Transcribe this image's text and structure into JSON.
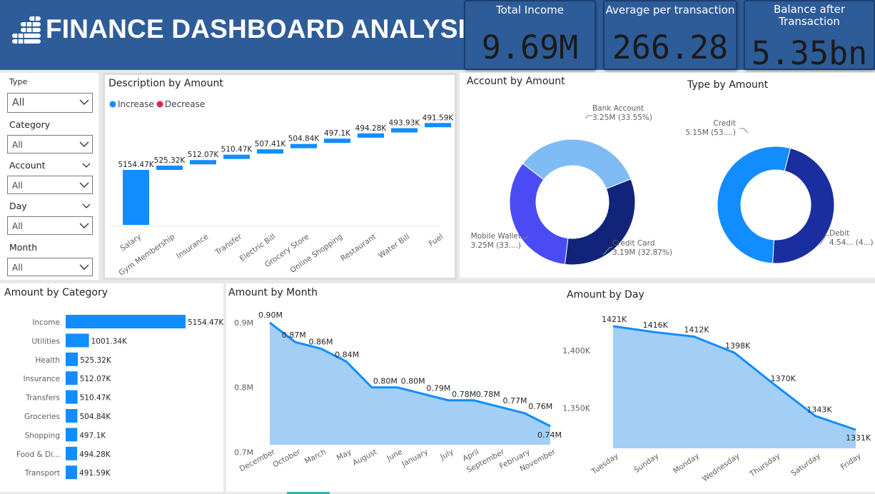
{
  "header": {
    "title": "FINANCE DASHBOARD ANALYSIS",
    "logo_icon": "coin-stack-icon"
  },
  "kpis": [
    {
      "label": "Total Income",
      "value": "9.69M"
    },
    {
      "label": "Average per transaction",
      "value": "266.28"
    },
    {
      "label": "Balance after Transaction",
      "value": "5.35bn"
    }
  ],
  "slicers": [
    {
      "label": "Type",
      "value": "All"
    },
    {
      "label": "Category",
      "value": "All"
    },
    {
      "label": "Account",
      "value": "All"
    },
    {
      "label": "Day",
      "value": "All"
    },
    {
      "label": "Month",
      "value": "All"
    }
  ],
  "colors": {
    "accent": "#118dff",
    "decrease": "#e6224d",
    "header": "#2e5c99",
    "area": "#a3cff7"
  },
  "chart_data": [
    {
      "id": "description",
      "type": "waterfall",
      "title": "Description by Amount",
      "legend": [
        {
          "name": "Increase",
          "color": "#118dff"
        },
        {
          "name": "Decrease",
          "color": "#e6224d"
        }
      ],
      "categories": [
        "Salary",
        "Gym Membership",
        "Insurance",
        "Transfer",
        "Electric Bill",
        "Grocery Store",
        "Online Shopping",
        "Restaurant",
        "Water Bill",
        "Fuel"
      ],
      "labels": [
        "5154.47K",
        "525.32K",
        "512.07K",
        "510.47K",
        "507.41K",
        "504.84K",
        "497.1K",
        "494.28K",
        "493.93K",
        "491.59K"
      ],
      "values": [
        5154.47,
        525.32,
        512.07,
        510.47,
        507.41,
        504.84,
        497.1,
        494.28,
        493.93,
        491.59
      ]
    },
    {
      "id": "account",
      "type": "donut",
      "title": "Account by Amount",
      "slices": [
        {
          "name": "Bank Account",
          "value": 33.55,
          "label": "3.25M (33.55%)",
          "color": "#7fbcf6"
        },
        {
          "name": "Credit Card",
          "value": 32.87,
          "label": "3.19M (32.87%)",
          "color": "#12247a"
        },
        {
          "name": "Mobile Wallet",
          "value": 33.58,
          "label": "3.25M (33....)",
          "color": "#4a4bf4"
        }
      ]
    },
    {
      "id": "type",
      "type": "donut",
      "title": "Type by Amount",
      "slices": [
        {
          "name": "Debit",
          "value": 46.85,
          "label": "4.54... (4...)",
          "color": "#1a2ea0"
        },
        {
          "name": "Credit",
          "value": 53.15,
          "label": "5.15M (53....)",
          "color": "#118dff"
        }
      ]
    },
    {
      "id": "category",
      "type": "bar",
      "title": "Amount by Category",
      "categories": [
        "Income",
        "Utilities",
        "Health",
        "Insurance",
        "Transfers",
        "Groceries",
        "Shopping",
        "Food & Di...",
        "Transport"
      ],
      "labels": [
        "5154.47K",
        "1001.34K",
        "525.32K",
        "512.07K",
        "510.47K",
        "504.84K",
        "497.1K",
        "494.28K",
        "491.59K"
      ],
      "values": [
        5154.47,
        1001.34,
        525.32,
        512.07,
        510.47,
        504.84,
        497.1,
        494.28,
        491.59
      ]
    },
    {
      "id": "month",
      "type": "area",
      "title": "Amount by Month",
      "categories": [
        "December",
        "October",
        "March",
        "May",
        "August",
        "June",
        "January",
        "July",
        "April",
        "September",
        "February",
        "November"
      ],
      "values": [
        0.9,
        0.87,
        0.86,
        0.84,
        0.8,
        0.8,
        0.79,
        0.78,
        0.78,
        0.77,
        0.76,
        0.74
      ],
      "labels": [
        "0.90M",
        "0.87M",
        "0.86M",
        "0.84M",
        "0.80M",
        "0.80M",
        "0.79M",
        "0.78M",
        "0.78M",
        "0.77M",
        "0.76M",
        "0.74M"
      ],
      "yticks": [
        "0.9M",
        "0.8M",
        "0.7M"
      ],
      "ytick_values": [
        0.9,
        0.8,
        0.7
      ],
      "ylim": [
        0.7,
        0.9
      ]
    },
    {
      "id": "day",
      "type": "area",
      "title": "Amount by Day",
      "categories": [
        "Tuesday",
        "Sunday",
        "Monday",
        "Wednesday",
        "Thursday",
        "Saturday",
        "Friday"
      ],
      "values": [
        1421,
        1416,
        1412,
        1398,
        1370,
        1343,
        1331
      ],
      "labels": [
        "1421K",
        "1416K",
        "1412K",
        "1398K",
        "1370K",
        "1343K",
        "1331K"
      ],
      "yticks": [
        "1,400K",
        "1,350K"
      ],
      "ytick_values": [
        1400,
        1350
      ],
      "ylim": [
        1330,
        1421
      ]
    }
  ]
}
